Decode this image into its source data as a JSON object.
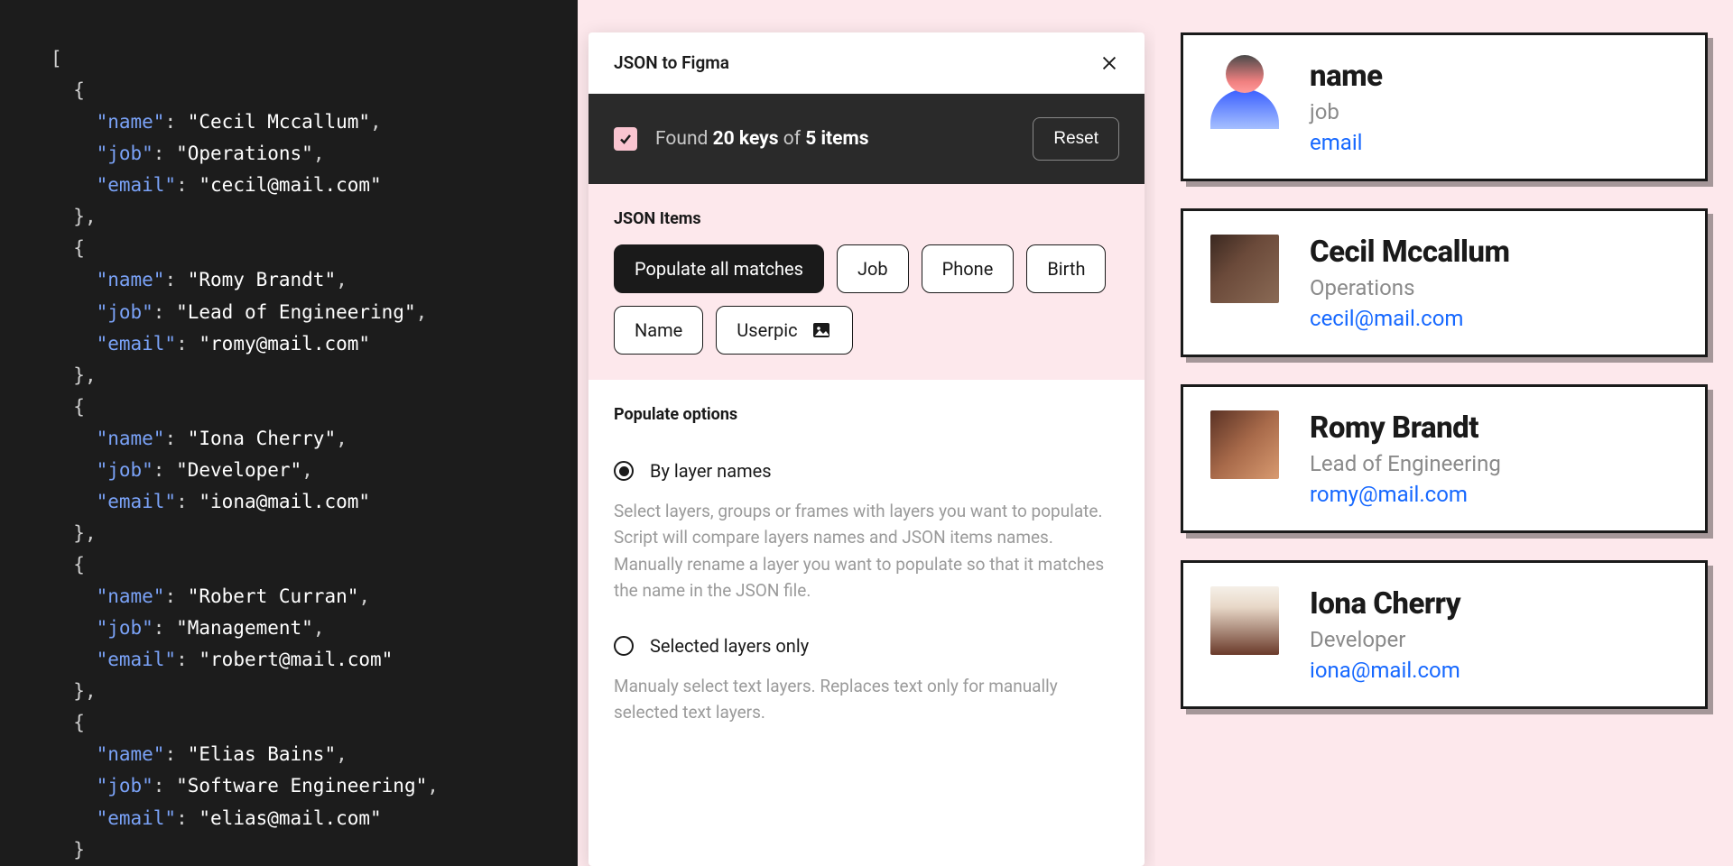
{
  "code": {
    "people": [
      {
        "name": "Cecil Mccallum",
        "job": "Operations",
        "email": "cecil@mail.com"
      },
      {
        "name": "Romy Brandt",
        "job": "Lead of Engineering",
        "email": "romy@mail.com"
      },
      {
        "name": "Iona Cherry",
        "job": "Developer",
        "email": "iona@mail.com"
      },
      {
        "name": "Robert Curran",
        "job": "Management",
        "email": "robert@mail.com"
      },
      {
        "name": "Elias Bains",
        "job": "Software Engineering",
        "email": "elias@mail.com"
      }
    ]
  },
  "plugin": {
    "title": "JSON to Figma",
    "status": {
      "found_prefix": "Found",
      "keys_count": "20 keys",
      "of_text": "of",
      "items_count": "5 items"
    },
    "reset_label": "Reset",
    "items_label": "JSON Items",
    "pills": {
      "populate_all": "Populate all matches",
      "job": "Job",
      "phone": "Phone",
      "birth": "Birth",
      "name": "Name",
      "userpic": "Userpic"
    },
    "options_label": "Populate options",
    "opt1": {
      "label": "By layer names",
      "desc": "Select layers, groups or frames with layers you want to populate. Script will compare layers names and JSON items names. Manually rename a layer you want to populate so that it matches the name in the JSON file."
    },
    "opt2": {
      "label": "Selected layers only",
      "desc": "Manualy select text layers. Replaces text only for manually selected text layers."
    }
  },
  "cards": [
    {
      "name": "name",
      "job": "job",
      "email": "email",
      "placeholder": true
    },
    {
      "name": "Cecil Mccallum",
      "job": "Operations",
      "email": "cecil@mail.com"
    },
    {
      "name": "Romy Brandt",
      "job": "Lead of Engineering",
      "email": "romy@mail.com"
    },
    {
      "name": "Iona Cherry",
      "job": "Developer",
      "email": "iona@mail.com"
    }
  ]
}
